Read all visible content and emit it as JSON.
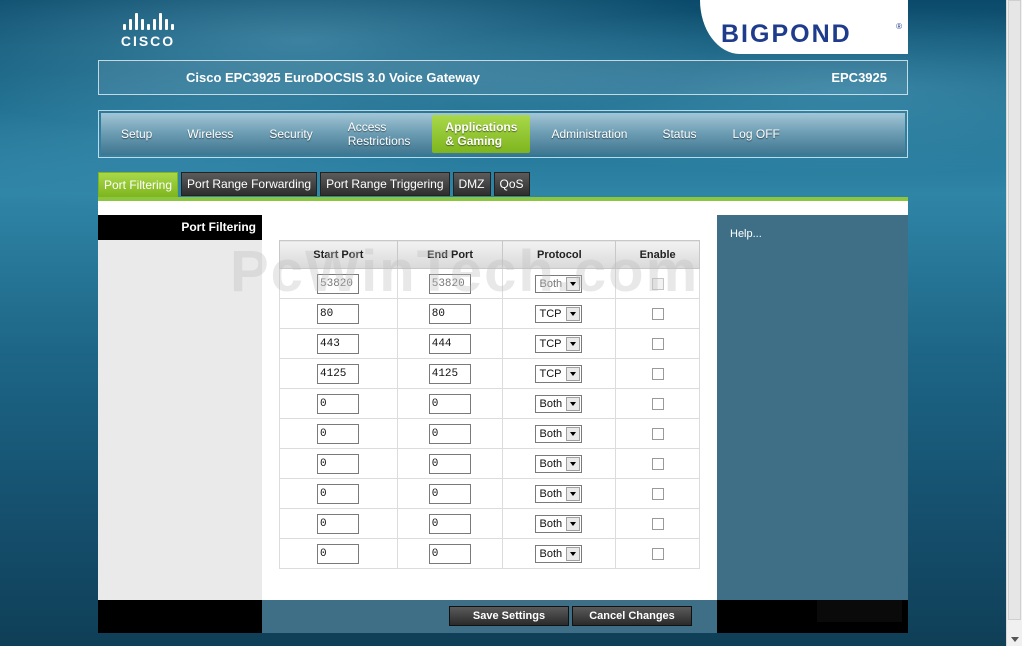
{
  "header": {
    "cisco_logo_text": "CISCO",
    "bigpond_logo_text": "BIGPOND",
    "bigpond_reg": "®",
    "device_title": "Cisco EPC3925 EuroDOCSIS 3.0 Voice Gateway",
    "model": "EPC3925"
  },
  "nav": {
    "items": [
      {
        "label": "Setup"
      },
      {
        "label": "Wireless"
      },
      {
        "label": "Security"
      },
      {
        "label_line1": "Access",
        "label_line2": "Restrictions"
      },
      {
        "label_line1": "Applications",
        "label_line2": "& Gaming",
        "active": true
      },
      {
        "label": "Administration"
      },
      {
        "label": "Status"
      },
      {
        "label": "Log OFF"
      }
    ]
  },
  "subtabs": [
    {
      "label": "Port Filtering",
      "active": true
    },
    {
      "label": "Port Range Forwarding"
    },
    {
      "label": "Port Range Triggering"
    },
    {
      "label": "DMZ"
    },
    {
      "label": "QoS"
    }
  ],
  "section_title": "Port Filtering",
  "help_link": "Help...",
  "watermark": "PcWinTech.com",
  "table": {
    "headers": [
      "Start Port",
      "End Port",
      "Protocol",
      "Enable"
    ],
    "rows": [
      {
        "start": "53820",
        "end": "53820",
        "protocol": "Both",
        "enabled": false,
        "disabled": true
      },
      {
        "start": "80",
        "end": "80",
        "protocol": "TCP",
        "enabled": false
      },
      {
        "start": "443",
        "end": "444",
        "protocol": "TCP",
        "enabled": false
      },
      {
        "start": "4125",
        "end": "4125",
        "protocol": "TCP",
        "enabled": false
      },
      {
        "start": "0",
        "end": "0",
        "protocol": "Both",
        "enabled": false
      },
      {
        "start": "0",
        "end": "0",
        "protocol": "Both",
        "enabled": false
      },
      {
        "start": "0",
        "end": "0",
        "protocol": "Both",
        "enabled": false
      },
      {
        "start": "0",
        "end": "0",
        "protocol": "Both",
        "enabled": false
      },
      {
        "start": "0",
        "end": "0",
        "protocol": "Both",
        "enabled": false
      },
      {
        "start": "0",
        "end": "0",
        "protocol": "Both",
        "enabled": false
      }
    ]
  },
  "buttons": {
    "save": "Save Settings",
    "cancel": "Cancel Changes"
  },
  "colors": {
    "accent_green": "#8cc63f",
    "panel_blue": "#3e6f86",
    "bigpond_blue": "#1f3c8c"
  }
}
